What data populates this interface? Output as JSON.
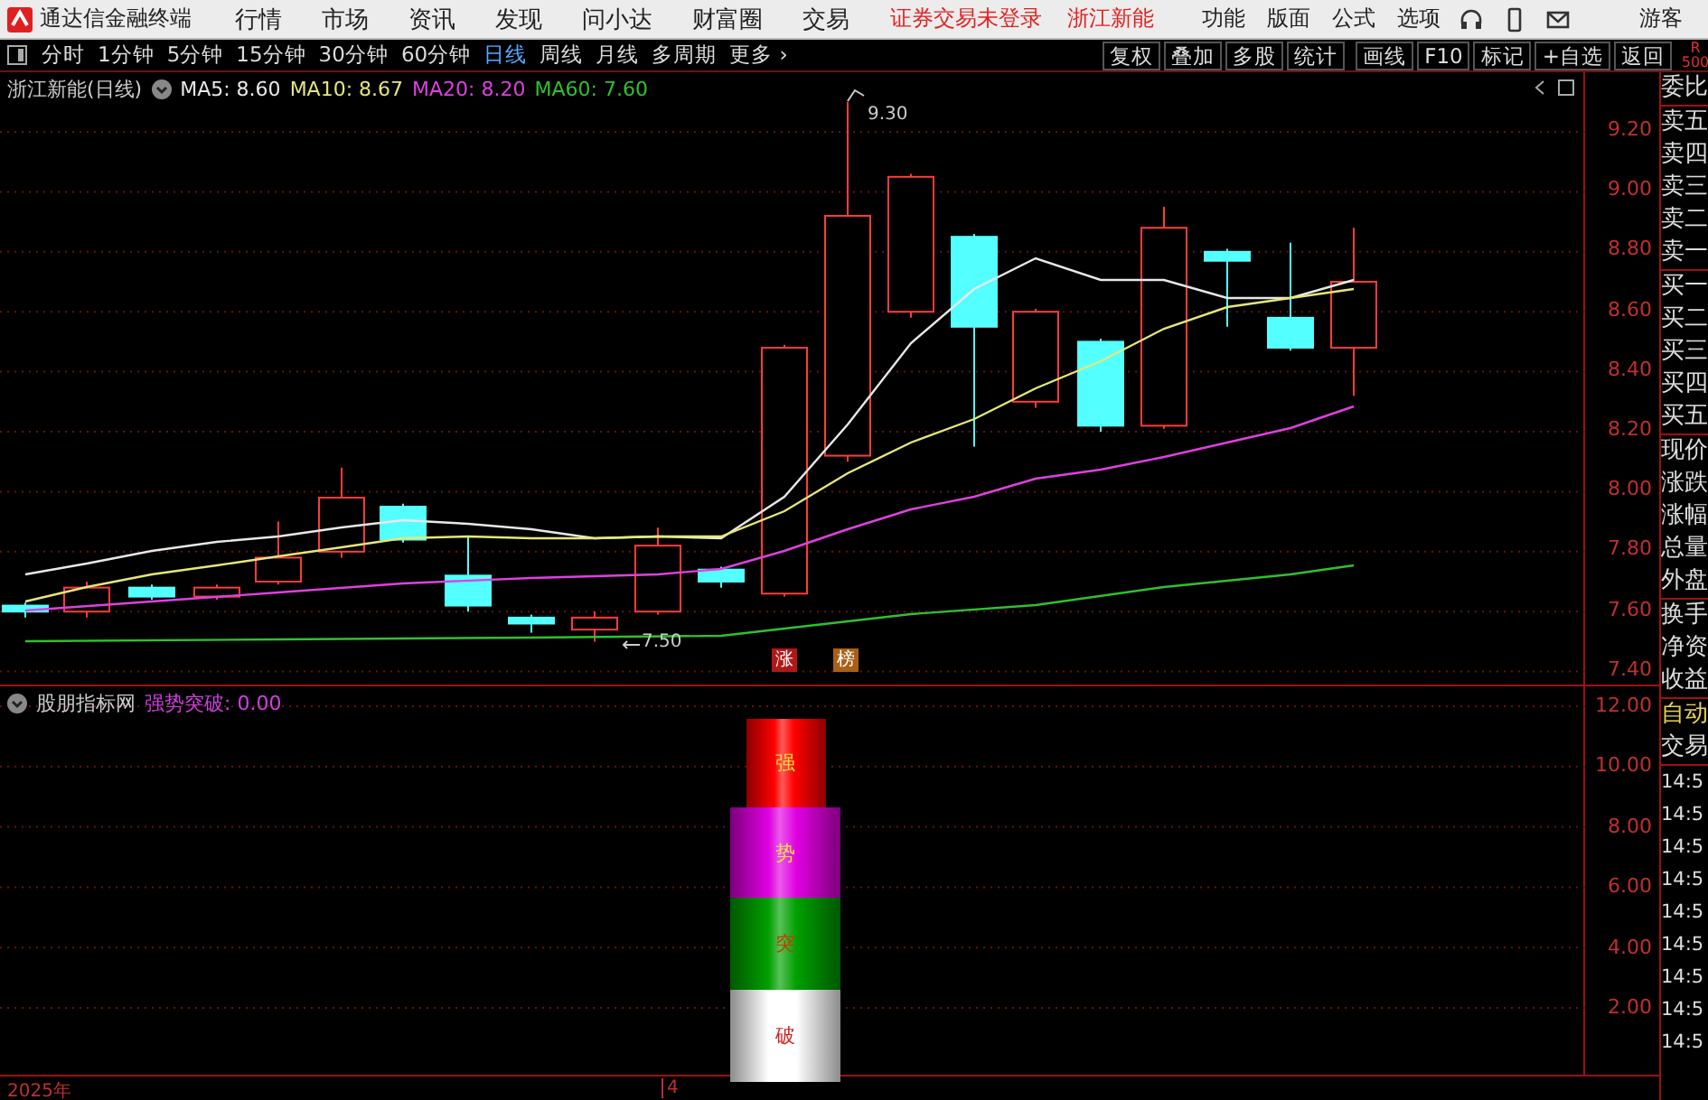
{
  "app_bar": {
    "title": "通达信金融终端",
    "menu": [
      "行情",
      "市场",
      "资讯",
      "发现",
      "问小达",
      "财富圈",
      "交易"
    ],
    "notices": [
      "证券交易未登录",
      "浙江新能"
    ],
    "tools": [
      "功能",
      "版面",
      "公式",
      "选项"
    ],
    "user": "游客"
  },
  "period_bar": {
    "periods": [
      {
        "label": "分时",
        "selected": false
      },
      {
        "label": "1分钟",
        "selected": false
      },
      {
        "label": "5分钟",
        "selected": false
      },
      {
        "label": "15分钟",
        "selected": false
      },
      {
        "label": "30分钟",
        "selected": false
      },
      {
        "label": "60分钟",
        "selected": false
      },
      {
        "label": "日线",
        "selected": true
      },
      {
        "label": "周线",
        "selected": false
      },
      {
        "label": "月线",
        "selected": false
      },
      {
        "label": "多周期",
        "selected": false
      }
    ],
    "more": "更多 ›",
    "actions": [
      "复权",
      "叠加",
      "多股",
      "统计",
      "画线",
      "F10",
      "标记",
      "+自选",
      "返回"
    ],
    "badge": [
      "R",
      "500"
    ]
  },
  "price_chart": {
    "title": "浙江新能(日线)",
    "ma": [
      {
        "label": "MA5: 8.60",
        "color": "#e8e8e8"
      },
      {
        "label": "MA10: 8.67",
        "color": "#e6e67a"
      },
      {
        "label": "MA20: 8.20",
        "color": "#e040e0"
      },
      {
        "label": "MA60: 7.60",
        "color": "#30c030"
      }
    ],
    "yticks": [
      "9.20",
      "9.00",
      "8.80",
      "8.60",
      "8.40",
      "8.20",
      "8.00",
      "7.80",
      "7.60",
      "7.40"
    ],
    "high_label": "9.30",
    "low_label": "7.50",
    "markers": [
      {
        "label": "涨",
        "color": "#b01818"
      },
      {
        "label": "榜",
        "color": "#a86018"
      }
    ]
  },
  "indicator": {
    "name": "股朋指标网",
    "value": "强势突破: 0.00",
    "yticks": [
      "12.00",
      "10.00",
      "8.00",
      "6.00",
      "4.00",
      "2.00"
    ],
    "bars": [
      {
        "label": "强",
        "color": "#ff0000"
      },
      {
        "label": "势",
        "color": "#e000e0"
      },
      {
        "label": "突",
        "color": "#00a000"
      },
      {
        "label": "破",
        "color": "#ffffff"
      }
    ]
  },
  "date_axis": [
    "2025年",
    "4"
  ],
  "quote_panel": {
    "sections": [
      [
        "委比"
      ],
      [
        "卖五",
        "卖四",
        "卖三",
        "卖二",
        "卖一"
      ],
      [
        "买一",
        "买二",
        "买三",
        "买四",
        "买五"
      ],
      [
        "现价",
        "涨跌",
        "涨幅",
        "总量",
        "外盘"
      ],
      [
        "换手",
        "净资",
        "收益"
      ]
    ],
    "mode": "自动",
    "trade": "交易",
    "times": [
      "14:5",
      "14:5",
      "14:5",
      "14:5",
      "14:5",
      "14:5",
      "14:5",
      "14:5",
      "14:5"
    ]
  }
}
